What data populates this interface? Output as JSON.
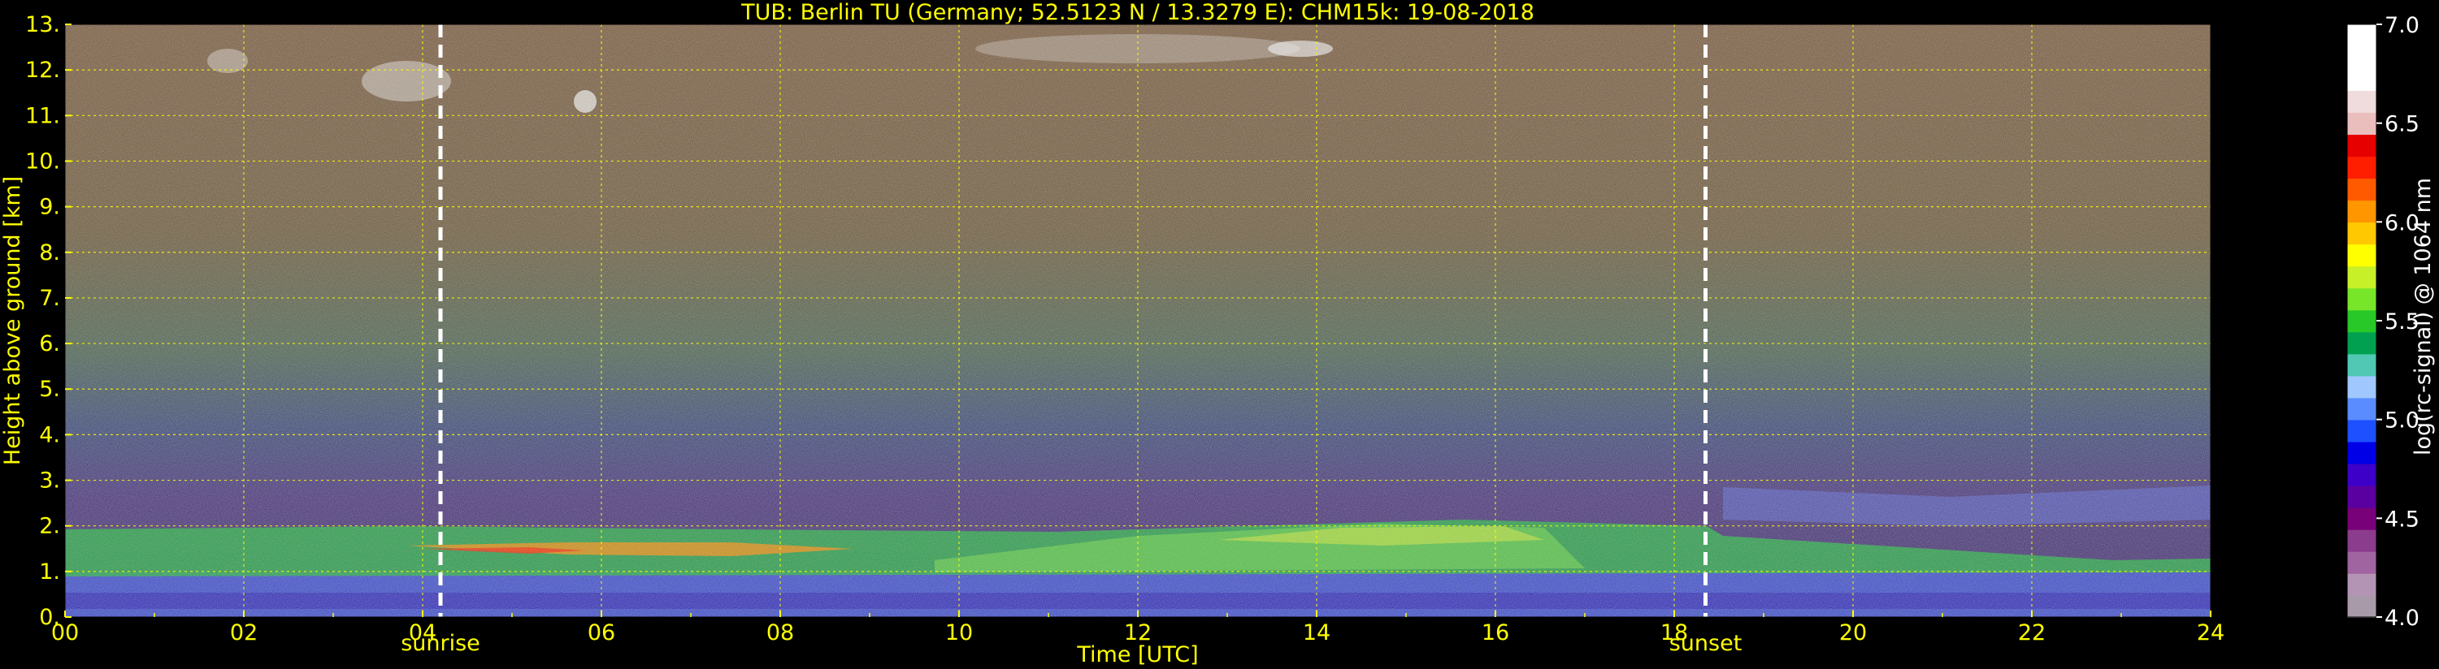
{
  "chart_data": {
    "type": "heatmap",
    "title": "TUB: Berlin TU (Germany; 52.5123 N / 13.3279 E):    CHM15k: 19-08-2018",
    "xlabel": "Time [UTC]",
    "ylabel": "Height above ground [km]",
    "xlim": [
      0,
      24
    ],
    "ylim": [
      0,
      13
    ],
    "x_ticks": [
      0,
      2,
      4,
      6,
      8,
      10,
      12,
      14,
      16,
      18,
      20,
      22,
      24
    ],
    "x_tick_labels": [
      "00",
      "02",
      "04",
      "06",
      "08",
      "10",
      "12",
      "14",
      "16",
      "18",
      "20",
      "22",
      "24"
    ],
    "y_ticks": [
      0,
      1,
      2,
      3,
      4,
      5,
      6,
      7,
      8,
      9,
      10,
      11,
      12,
      13
    ],
    "y_tick_labels": [
      "0.",
      "1.",
      "2.",
      "3.",
      "4.",
      "5.",
      "6.",
      "7.",
      "8.",
      "9.",
      "10.",
      "11.",
      "12.",
      "13."
    ],
    "grid": true,
    "markers": [
      {
        "label": "sunrise",
        "x": 4.2
      },
      {
        "label": "sunset",
        "x": 18.35
      }
    ],
    "colorbar": {
      "label": "log(rc-signal) @ 1064 nm",
      "range": [
        4.0,
        7.0
      ],
      "ticks": [
        4.0,
        4.5,
        5.0,
        5.5,
        6.0,
        6.5,
        7.0
      ],
      "tick_labels": [
        "4.0",
        "4.5",
        "5.0",
        "5.5",
        "6.0",
        "6.5",
        "7.0"
      ],
      "colors": [
        "#a89aa8",
        "#b494b4",
        "#a064a0",
        "#8c3c8c",
        "#780078",
        "#5a00a0",
        "#3c00c8",
        "#0000e6",
        "#1e50ff",
        "#5a8cff",
        "#a0c8ff",
        "#50c8b4",
        "#00a050",
        "#28c828",
        "#78e628",
        "#c8f028",
        "#ffff00",
        "#ffc800",
        "#ff9600",
        "#ff5a00",
        "#ff1e00",
        "#e60000",
        "#ebbebe",
        "#f0dcdc",
        "#ffffff",
        "#ffffff",
        "#ffffff"
      ]
    },
    "colors": {
      "text": "#ffff00",
      "grid": "#ffff00",
      "marker": "#ffffff",
      "background": "#000000"
    }
  }
}
